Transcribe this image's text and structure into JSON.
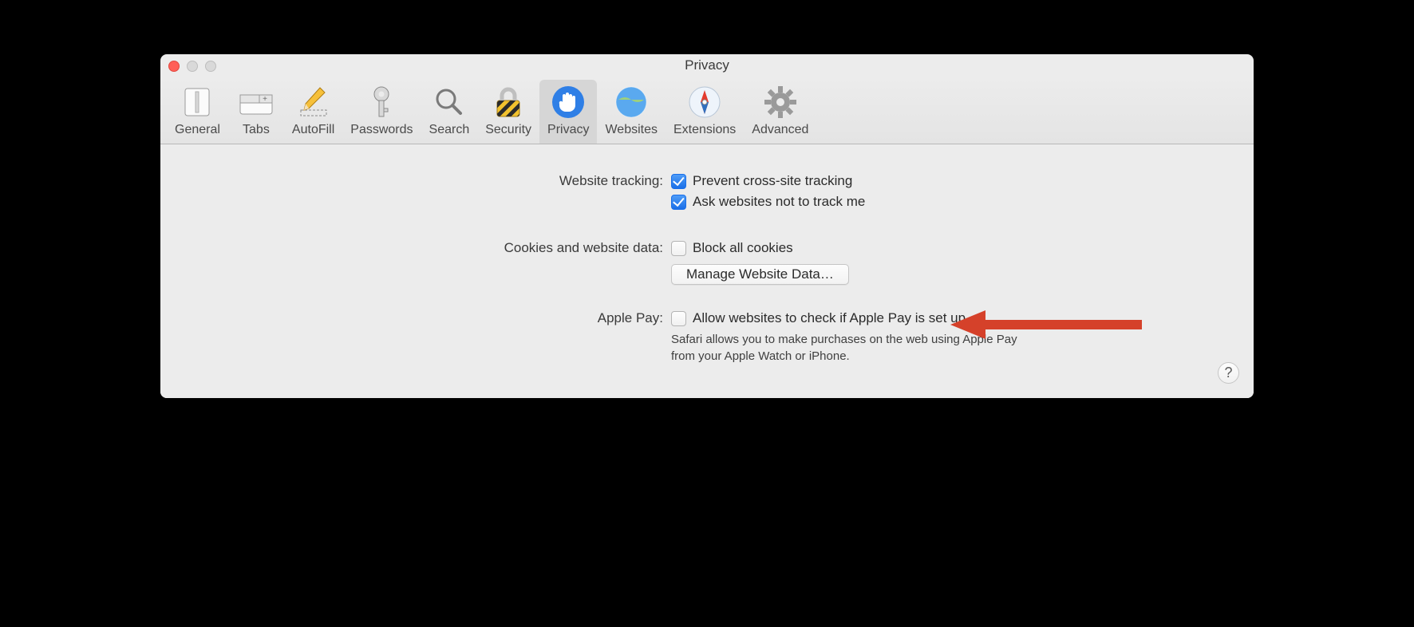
{
  "window": {
    "title": "Privacy"
  },
  "toolbar": {
    "items": [
      {
        "label": "General"
      },
      {
        "label": "Tabs"
      },
      {
        "label": "AutoFill"
      },
      {
        "label": "Passwords"
      },
      {
        "label": "Search"
      },
      {
        "label": "Security"
      },
      {
        "label": "Privacy"
      },
      {
        "label": "Websites"
      },
      {
        "label": "Extensions"
      },
      {
        "label": "Advanced"
      }
    ],
    "active": "Privacy"
  },
  "section_tracking": {
    "label": "Website tracking:",
    "opt1": "Prevent cross-site tracking",
    "opt1_checked": true,
    "opt2": "Ask websites not to track me",
    "opt2_checked": true
  },
  "section_cookies": {
    "label": "Cookies and website data:",
    "opt1": "Block all cookies",
    "opt1_checked": false,
    "button": "Manage Website Data…"
  },
  "section_applepay": {
    "label": "Apple Pay:",
    "opt1": "Allow websites to check if Apple Pay is set up",
    "opt1_checked": false,
    "desc": "Safari allows you to make purchases on the web using Apple Pay from your Apple Watch or iPhone."
  },
  "help": "?",
  "annotation": {
    "color": "#d5412a"
  }
}
